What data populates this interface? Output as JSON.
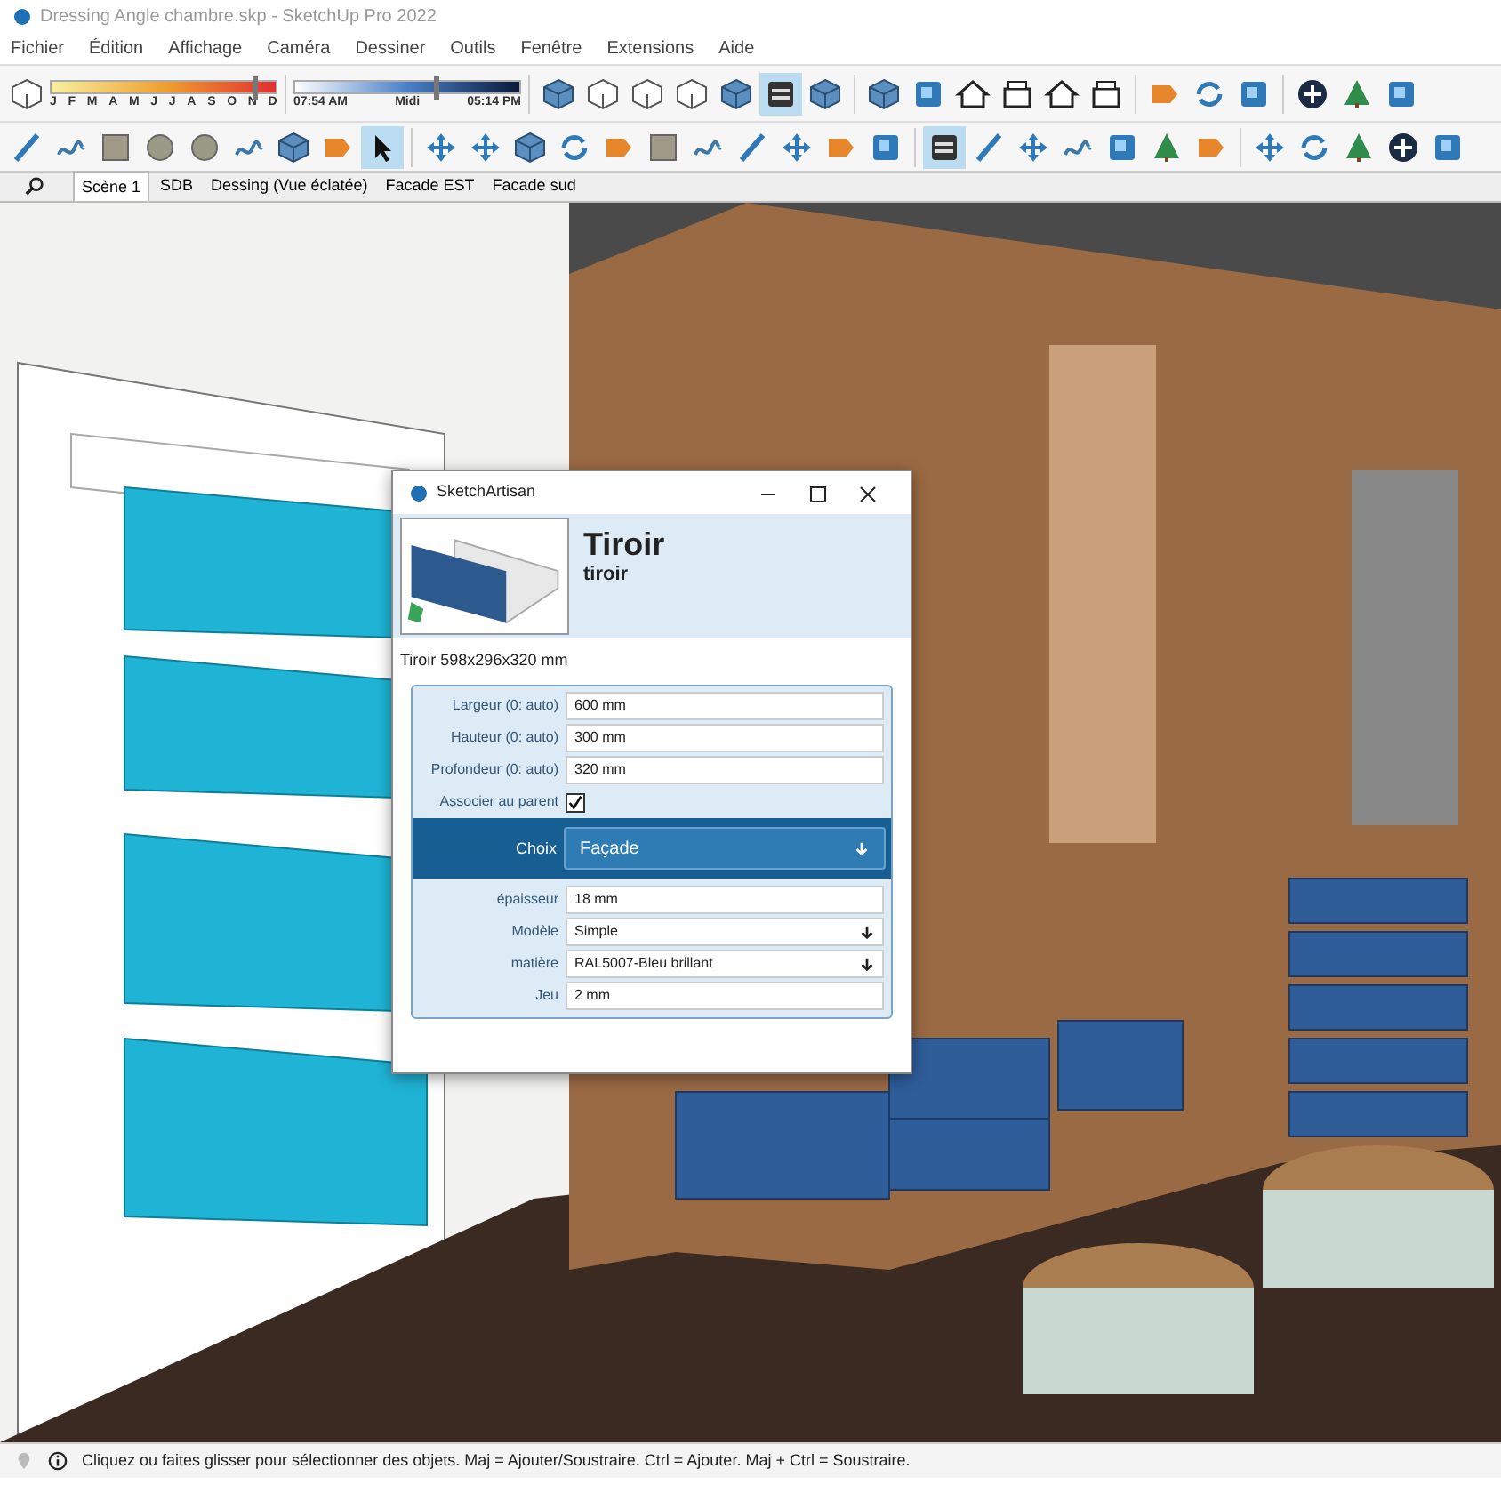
{
  "window": {
    "title": "Dressing Angle chambre.skp - SketchUp Pro 2022"
  },
  "menu": [
    "Fichier",
    "Édition",
    "Affichage",
    "Caméra",
    "Dessiner",
    "Outils",
    "Fenêtre",
    "Extensions",
    "Aide"
  ],
  "shadow_bar": {
    "months": [
      "J",
      "F",
      "M",
      "A",
      "M",
      "J",
      "J",
      "A",
      "S",
      "O",
      "N",
      "D"
    ],
    "month_slider": {
      "level": 0.9
    },
    "time_labels": [
      "07:54 AM",
      "Midi",
      "05:14 PM"
    ],
    "time_slider": {
      "level": 0.62
    }
  },
  "toolbar_1": [
    {
      "kind": "cube",
      "selected": false
    },
    {
      "kind": "outline",
      "selected": false
    },
    {
      "kind": "outline",
      "selected": false
    },
    {
      "kind": "outline",
      "selected": false
    },
    {
      "kind": "cube",
      "selected": false
    },
    {
      "kind": "stripes",
      "selected": true
    },
    {
      "kind": "cube",
      "selected": false
    },
    {
      "kind": "cube",
      "selected": false
    },
    {
      "kind": "tile",
      "selected": false
    },
    {
      "kind": "house",
      "selected": false
    },
    {
      "kind": "box",
      "selected": false
    },
    {
      "kind": "house",
      "selected": false
    },
    {
      "kind": "box",
      "selected": false
    },
    {
      "kind": "tag",
      "selected": false
    },
    {
      "kind": "rotate",
      "selected": false
    },
    {
      "kind": "tile",
      "selected": false
    },
    {
      "kind": "plus",
      "selected": false
    },
    {
      "kind": "tree",
      "selected": false
    },
    {
      "kind": "tile",
      "selected": false
    }
  ],
  "toolbar_2": [
    {
      "kind": "pencil",
      "selected": false
    },
    {
      "kind": "curve",
      "selected": false
    },
    {
      "kind": "square",
      "selected": false
    },
    {
      "kind": "circle",
      "selected": false
    },
    {
      "kind": "circle",
      "selected": false
    },
    {
      "kind": "curve",
      "selected": false
    },
    {
      "kind": "cube",
      "selected": false
    },
    {
      "kind": "tag",
      "selected": false
    },
    {
      "kind": "cursor",
      "selected": true
    },
    {
      "kind": "move",
      "selected": false
    },
    {
      "kind": "move",
      "selected": false
    },
    {
      "kind": "cube",
      "selected": false
    },
    {
      "kind": "rotate",
      "selected": false
    },
    {
      "kind": "tag",
      "selected": false
    },
    {
      "kind": "square",
      "selected": false
    },
    {
      "kind": "curve",
      "selected": false
    },
    {
      "kind": "pencil",
      "selected": false
    },
    {
      "kind": "move",
      "selected": false
    },
    {
      "kind": "tag",
      "selected": false
    },
    {
      "kind": "tile",
      "selected": false
    },
    {
      "kind": "stripes",
      "selected": true
    },
    {
      "kind": "pencil",
      "selected": false
    },
    {
      "kind": "move",
      "selected": false
    },
    {
      "kind": "curve",
      "selected": false
    },
    {
      "kind": "tile",
      "selected": false
    },
    {
      "kind": "tree",
      "selected": false
    },
    {
      "kind": "tag",
      "selected": false
    },
    {
      "kind": "move",
      "selected": false
    },
    {
      "kind": "rotate",
      "selected": false
    },
    {
      "kind": "tree",
      "selected": false
    },
    {
      "kind": "plus",
      "selected": false
    },
    {
      "kind": "tile",
      "selected": false
    }
  ],
  "scene_tabs": [
    {
      "label": "Scène 1",
      "selected": true
    },
    {
      "label": "SDB",
      "selected": false
    },
    {
      "label": "Dessing (Vue éclatée)",
      "selected": false
    },
    {
      "label": "Facade EST",
      "selected": false
    },
    {
      "label": "Facade sud",
      "selected": false
    }
  ],
  "dialog": {
    "title": "SketchArtisan",
    "name": "Tiroir",
    "subtitle": "tiroir",
    "summary": "Tiroir 598x296x320 mm",
    "fields": [
      {
        "kind": "text",
        "label": "Largeur (0: auto)",
        "value": "600 mm"
      },
      {
        "kind": "text",
        "label": "Hauteur (0: auto)",
        "value": "300 mm"
      },
      {
        "kind": "text",
        "label": "Profondeur (0: auto)",
        "value": "320 mm"
      },
      {
        "kind": "checkbox",
        "label": "Associer au parent",
        "checked": true
      }
    ],
    "choice": {
      "label": "Choix",
      "value": "Façade"
    },
    "sub_fields": [
      {
        "kind": "text",
        "label": "épaisseur",
        "value": "18 mm"
      },
      {
        "kind": "select",
        "label": "Modèle",
        "value": "Simple"
      },
      {
        "kind": "select",
        "label": "matière",
        "value": "RAL5007-Bleu brillant"
      },
      {
        "kind": "text",
        "label": "Jeu",
        "value": "2 mm"
      }
    ]
  },
  "status_bar": {
    "text": "Cliquez ou faites glisser pour sélectionner des objets. Maj = Ajouter/Soustraire. Ctrl = Ajouter. Maj + Ctrl = Soustraire."
  }
}
